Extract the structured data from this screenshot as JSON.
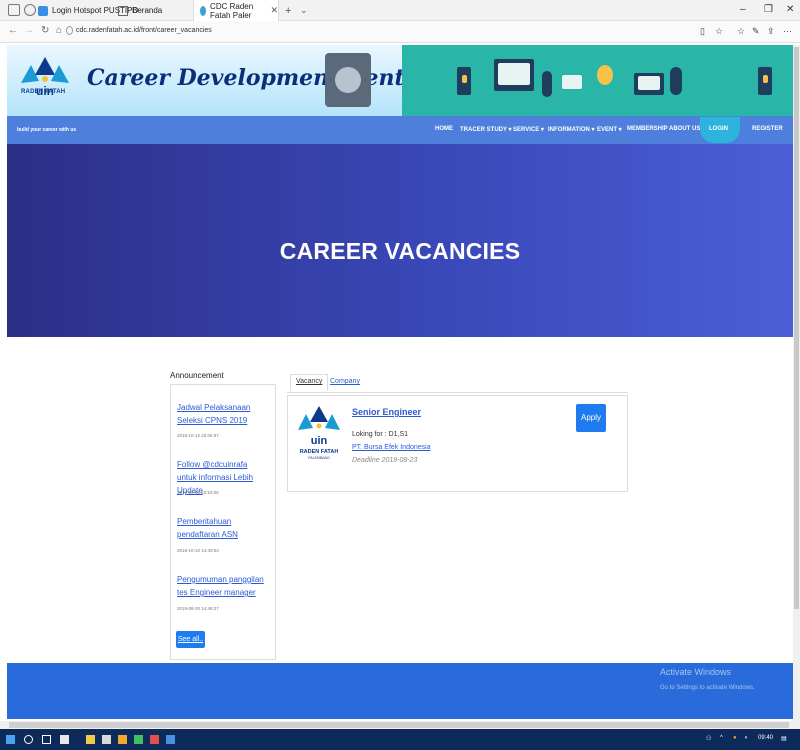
{
  "browser": {
    "tabs": [
      {
        "label": "Login Hotspot PUSTIPD"
      },
      {
        "label": "Beranda"
      },
      {
        "label": "CDC Raden Fatah Paler",
        "active": true
      }
    ],
    "new_tab": "+",
    "tab_menu": "⌄",
    "url": "cdc.radenfatah.ac.id/front/career_vacancies"
  },
  "site": {
    "brand": "Career Development Center",
    "logo_text": "RADEN FATAH",
    "logo_sub": "PALEMBANG",
    "logo_word": "uin",
    "tagline": "build your career with us",
    "nav": [
      {
        "label": "HOME"
      },
      {
        "label": "TRACER STUDY ▾"
      },
      {
        "label": "SERVICE ▾"
      },
      {
        "label": "INFORMATION ▾"
      },
      {
        "label": "EVENT ▾"
      },
      {
        "label": "MEMBERSHIP"
      },
      {
        "label": "ABOUT US"
      },
      {
        "label": "LOGIN"
      },
      {
        "label": "REGISTER"
      }
    ]
  },
  "hero": {
    "title": "CAREER VACANCIES"
  },
  "announcement": {
    "heading": "Announcement",
    "items": [
      {
        "title": "Jadwal Pelaksanaan Seleksi CPNS 2019",
        "date": "2019-10-12 22:06:57"
      },
      {
        "title": "Follow @cdcuinrafa untuk informasi Lebih Update",
        "date": "2019-10-12 22:53:06"
      },
      {
        "title": "Pemberitahuan pendaftaran ASN",
        "date": "2019-10-10 14:40:53"
      },
      {
        "title": "Pengumuman panggilan tes Engineer manager",
        "date": "2019-08-20 14:49:37"
      }
    ],
    "see_all": "See all.."
  },
  "tabs": {
    "vacancy": "Vacancy",
    "company": "Company"
  },
  "vacancy": {
    "title": "Senior Engineer",
    "looking_for": "Loking for : D1,S1",
    "company": "PT. Bursa Efek Indonesia",
    "deadline": "Deadline 2019-08-23",
    "apply": "Apply"
  },
  "watermark": {
    "line1": "Activate Windows",
    "line2": "Go to Settings to activate Windows."
  },
  "tray": {
    "time": "09:40"
  }
}
